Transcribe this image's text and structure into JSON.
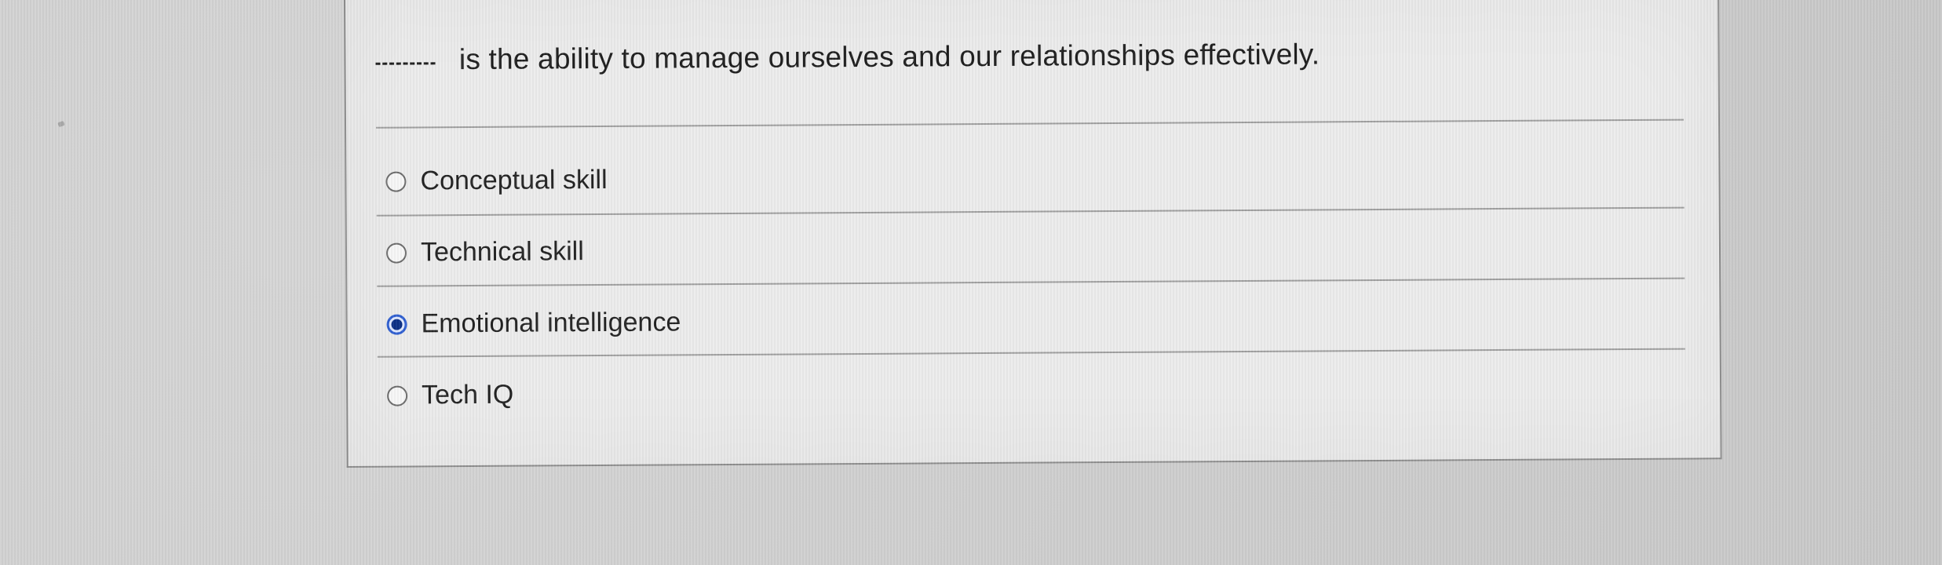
{
  "question": {
    "blank": "_____",
    "text": "is the ability to manage ourselves and our relationships effectively."
  },
  "options": [
    {
      "label": "Conceptual skill",
      "selected": false
    },
    {
      "label": "Technical skill",
      "selected": false
    },
    {
      "label": "Emotional intelligence",
      "selected": true
    },
    {
      "label": "Tech IQ",
      "selected": false
    }
  ],
  "colors": {
    "accent": "#2f5fd1",
    "accent_dark": "#0b2f86",
    "text": "#1e1e1e",
    "divider": "#9f9f9f"
  }
}
